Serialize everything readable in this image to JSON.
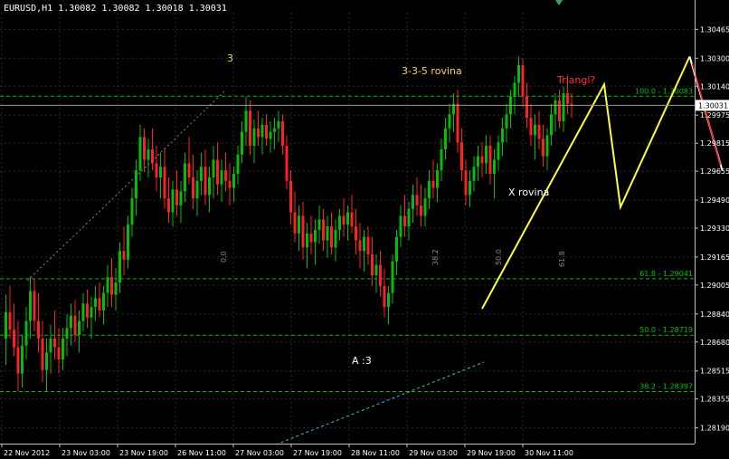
{
  "window": {
    "header_text": "EURUSD,H1  1.30082 1.30082 1.30018 1.30031"
  },
  "colors": {
    "background": "#000000",
    "grid": "#1f2f1f",
    "bull_candle": "#00c000",
    "bear_candle": "#ff2020",
    "fib_line": "#00c000",
    "pattern_yellow": "#ffff33",
    "pattern_white": "#ffffff",
    "pattern_red": "#ff2020",
    "trend_cyan": "#3fc0e0",
    "label_yellow": "#ffd24a",
    "label_red": "#ff3030",
    "axis_text": "#ffffff",
    "price_marker_bg": "#ffffff"
  },
  "chart_data": {
    "type": "candlestick",
    "symbol": "EURUSD",
    "timeframe": "H1",
    "ohlc_header": {
      "open": 1.30082,
      "high": 1.30082,
      "low": 1.30018,
      "close": 1.30031
    },
    "current_price": "1.30031",
    "y_range": [
      1.281,
      1.3056
    ],
    "y_ticks": [
      "1.30465",
      "1.30300",
      "1.30140",
      "1.29975",
      "1.29815",
      "1.29655",
      "1.29490",
      "1.29330",
      "1.29165",
      "1.29005",
      "1.28840",
      "1.28680",
      "1.28515",
      "1.28355",
      "1.28190"
    ],
    "x_ticks": [
      "22 Nov 2012",
      "23 Nov 03:00",
      "23 Nov 19:00",
      "26 Nov 11:00",
      "27 Nov 03:00",
      "27 Nov 19:00",
      "28 Nov 11:00",
      "29 Nov 03:00",
      "29 Nov 19:00",
      "30 Nov 11:00"
    ],
    "fib_levels": [
      {
        "label": "100.0 - 1.30083",
        "price": 1.30083
      },
      {
        "label": "61.8 - 1.29041",
        "price": 1.29041
      },
      {
        "label": "50.0 - 1.28719",
        "price": 1.28719
      },
      {
        "label": "38.2 - 1.28397",
        "price": 1.28397
      }
    ],
    "fib_time_labels": [
      "0.0",
      "38.2",
      "50.0",
      "61.8"
    ],
    "annotations": {
      "wave_3": "3",
      "wave_335": "3-3-5 rovina",
      "triangle": "Triangl?",
      "x_flat": "X rovina",
      "a3": "A :3"
    },
    "pattern_points": [
      {
        "bar": 117,
        "price": 1.2887
      },
      {
        "bar": 147,
        "price": 1.3015
      },
      {
        "bar": 151,
        "price": 1.2945
      },
      {
        "bar": 168,
        "price": 1.3031
      },
      {
        "bar": 176,
        "price": 1.2966
      }
    ],
    "zigzag_tail": [
      {
        "bar": 168,
        "price": 1.3031
      },
      {
        "bar": 176,
        "price": 1.2966
      }
    ],
    "candles": [
      [
        1.287,
        1.2895,
        1.2855,
        1.2885
      ],
      [
        1.2885,
        1.29,
        1.287,
        1.2875
      ],
      [
        1.2875,
        1.289,
        1.286,
        1.2865
      ],
      [
        1.2865,
        1.288,
        1.284,
        1.285
      ],
      [
        1.285,
        1.2872,
        1.2842,
        1.2866
      ],
      [
        1.2866,
        1.2888,
        1.2858,
        1.288
      ],
      [
        1.288,
        1.2905,
        1.287,
        1.2897
      ],
      [
        1.2897,
        1.2904,
        1.2874,
        1.288
      ],
      [
        1.288,
        1.2896,
        1.2862,
        1.287
      ],
      [
        1.287,
        1.288,
        1.2845,
        1.2852
      ],
      [
        1.2852,
        1.287,
        1.284,
        1.2862
      ],
      [
        1.2862,
        1.2878,
        1.285,
        1.287
      ],
      [
        1.287,
        1.2886,
        1.2858,
        1.2865
      ],
      [
        1.2865,
        1.2876,
        1.285,
        1.2858
      ],
      [
        1.2858,
        1.2876,
        1.2852,
        1.287
      ],
      [
        1.287,
        1.2884,
        1.286,
        1.2876
      ],
      [
        1.2876,
        1.289,
        1.2866,
        1.2883
      ],
      [
        1.2883,
        1.2892,
        1.2868,
        1.2872
      ],
      [
        1.2872,
        1.2886,
        1.2862,
        1.288
      ],
      [
        1.288,
        1.2896,
        1.2874,
        1.289
      ],
      [
        1.289,
        1.2898,
        1.2876,
        1.2882
      ],
      [
        1.2882,
        1.2894,
        1.287,
        1.2888
      ],
      [
        1.2888,
        1.29,
        1.288,
        1.2893
      ],
      [
        1.2893,
        1.2902,
        1.2882,
        1.2886
      ],
      [
        1.2886,
        1.29,
        1.2878,
        1.2896
      ],
      [
        1.2896,
        1.2912,
        1.2888,
        1.2905
      ],
      [
        1.2905,
        1.2916,
        1.2888,
        1.2895
      ],
      [
        1.2895,
        1.291,
        1.2886,
        1.2902
      ],
      [
        1.2902,
        1.2925,
        1.2896,
        1.292
      ],
      [
        1.292,
        1.2934,
        1.2906,
        1.2915
      ],
      [
        1.2915,
        1.294,
        1.291,
        1.2935
      ],
      [
        1.2935,
        1.2956,
        1.2928,
        1.295
      ],
      [
        1.295,
        1.2972,
        1.294,
        1.2966
      ],
      [
        1.2966,
        1.2992,
        1.296,
        1.2985
      ],
      [
        1.2985,
        1.299,
        1.2965,
        1.2972
      ],
      [
        1.2972,
        1.2984,
        1.2962,
        1.2978
      ],
      [
        1.2978,
        1.299,
        1.2966,
        1.297
      ],
      [
        1.297,
        1.298,
        1.2954,
        1.2962
      ],
      [
        1.2962,
        1.2976,
        1.295,
        1.2968
      ],
      [
        1.2968,
        1.2978,
        1.2944,
        1.295
      ],
      [
        1.295,
        1.2962,
        1.2936,
        1.2942
      ],
      [
        1.2942,
        1.296,
        1.2934,
        1.2955
      ],
      [
        1.2955,
        1.2966,
        1.294,
        1.2946
      ],
      [
        1.2946,
        1.296,
        1.2936,
        1.2954
      ],
      [
        1.2954,
        1.2976,
        1.2948,
        1.297
      ],
      [
        1.297,
        1.2985,
        1.2958,
        1.2962
      ],
      [
        1.2962,
        1.2975,
        1.2944,
        1.295
      ],
      [
        1.295,
        1.2966,
        1.294,
        1.296
      ],
      [
        1.296,
        1.2976,
        1.2952,
        1.2968
      ],
      [
        1.2968,
        1.2978,
        1.2946,
        1.2952
      ],
      [
        1.2952,
        1.2968,
        1.2942,
        1.2962
      ],
      [
        1.2962,
        1.298,
        1.295,
        1.2972
      ],
      [
        1.2972,
        1.2982,
        1.2952,
        1.2958
      ],
      [
        1.2958,
        1.2972,
        1.2948,
        1.2966
      ],
      [
        1.2966,
        1.2976,
        1.2954,
        1.296
      ],
      [
        1.296,
        1.297,
        1.2946,
        1.2956
      ],
      [
        1.2956,
        1.2968,
        1.2948,
        1.2964
      ],
      [
        1.2964,
        1.298,
        1.2958,
        1.2975
      ],
      [
        1.2975,
        1.2994,
        1.297,
        1.2988
      ],
      [
        1.2988,
        1.3008,
        1.298,
        1.3
      ],
      [
        1.3,
        1.3006,
        1.2975,
        1.298
      ],
      [
        1.298,
        1.2995,
        1.297,
        1.299
      ],
      [
        1.299,
        1.3,
        1.298,
        1.2985
      ],
      [
        1.2985,
        1.2996,
        1.2975,
        1.2992
      ],
      [
        1.2992,
        1.2998,
        1.298,
        1.2984
      ],
      [
        1.2984,
        1.2994,
        1.2976,
        1.2988
      ],
      [
        1.2988,
        1.2996,
        1.2978,
        1.299
      ],
      [
        1.299,
        1.3,
        1.2982,
        1.2994
      ],
      [
        1.2994,
        1.2998,
        1.2975,
        1.298
      ],
      [
        1.298,
        1.2986,
        1.2955,
        1.296
      ],
      [
        1.296,
        1.2966,
        1.2935,
        1.2942
      ],
      [
        1.2942,
        1.2954,
        1.2925,
        1.293
      ],
      [
        1.293,
        1.2946,
        1.292,
        1.294
      ],
      [
        1.294,
        1.2948,
        1.2915,
        1.2922
      ],
      [
        1.2922,
        1.2936,
        1.291,
        1.293
      ],
      [
        1.293,
        1.294,
        1.2918,
        1.2925
      ],
      [
        1.2925,
        1.2938,
        1.2912,
        1.2932
      ],
      [
        1.2932,
        1.2946,
        1.2924,
        1.2938
      ],
      [
        1.2938,
        1.2944,
        1.292,
        1.2926
      ],
      [
        1.2926,
        1.294,
        1.2916,
        1.2934
      ],
      [
        1.2934,
        1.2942,
        1.2918,
        1.2922
      ],
      [
        1.2922,
        1.2938,
        1.2914,
        1.2932
      ],
      [
        1.2932,
        1.2944,
        1.2926,
        1.294
      ],
      [
        1.294,
        1.295,
        1.2928,
        1.2935
      ],
      [
        1.2935,
        1.2946,
        1.2926,
        1.2942
      ],
      [
        1.2942,
        1.2952,
        1.293,
        1.2934
      ],
      [
        1.2934,
        1.2944,
        1.2918,
        1.2926
      ],
      [
        1.2926,
        1.2936,
        1.291,
        1.292
      ],
      [
        1.292,
        1.2932,
        1.2908,
        1.2928
      ],
      [
        1.2928,
        1.2934,
        1.2912,
        1.2918
      ],
      [
        1.2918,
        1.2928,
        1.29,
        1.2906
      ],
      [
        1.2906,
        1.2918,
        1.2896,
        1.2912
      ],
      [
        1.2912,
        1.292,
        1.2894,
        1.29
      ],
      [
        1.29,
        1.291,
        1.2882,
        1.2888
      ],
      [
        1.2888,
        1.29,
        1.2878,
        1.2896
      ],
      [
        1.2896,
        1.2918,
        1.289,
        1.2914
      ],
      [
        1.2914,
        1.2932,
        1.2906,
        1.2928
      ],
      [
        1.2928,
        1.2946,
        1.2922,
        1.294
      ],
      [
        1.294,
        1.2952,
        1.2928,
        1.2934
      ],
      [
        1.2934,
        1.2948,
        1.2926,
        1.2944
      ],
      [
        1.2944,
        1.2958,
        1.2936,
        1.2952
      ],
      [
        1.2952,
        1.2962,
        1.294,
        1.2946
      ],
      [
        1.2946,
        1.2958,
        1.2934,
        1.294
      ],
      [
        1.294,
        1.2956,
        1.2934,
        1.295
      ],
      [
        1.295,
        1.2966,
        1.2944,
        1.296
      ],
      [
        1.296,
        1.2972,
        1.295,
        1.2956
      ],
      [
        1.2956,
        1.297,
        1.2948,
        1.2966
      ],
      [
        1.2966,
        1.2984,
        1.296,
        1.2978
      ],
      [
        1.2978,
        1.2996,
        1.2972,
        1.299
      ],
      [
        1.299,
        1.3004,
        1.2982,
        1.2998
      ],
      [
        1.2998,
        1.301,
        1.2988,
        1.3004
      ],
      [
        1.3004,
        1.3012,
        1.2976,
        1.2982
      ],
      [
        1.2982,
        1.299,
        1.296,
        1.2966
      ],
      [
        1.2966,
        1.2972,
        1.2946,
        1.2952
      ],
      [
        1.2952,
        1.2966,
        1.2945,
        1.296
      ],
      [
        1.296,
        1.2974,
        1.2954,
        1.2968
      ],
      [
        1.2968,
        1.298,
        1.296,
        1.2974
      ],
      [
        1.2974,
        1.2982,
        1.2962,
        1.297
      ],
      [
        1.297,
        1.2986,
        1.2964,
        1.298
      ],
      [
        1.298,
        1.2986,
        1.2958,
        1.2964
      ],
      [
        1.2964,
        1.2978,
        1.295,
        1.2972
      ],
      [
        1.2972,
        1.2986,
        1.2966,
        1.2982
      ],
      [
        1.2982,
        1.2996,
        1.2974,
        1.299
      ],
      [
        1.299,
        1.3004,
        1.2982,
        1.2998
      ],
      [
        1.2998,
        1.3012,
        1.299,
        1.3008
      ],
      [
        1.3008,
        1.302,
        1.2998,
        1.3016
      ],
      [
        1.3016,
        1.3031,
        1.3008,
        1.3026
      ],
      [
        1.3026,
        1.303,
        1.3002,
        1.3008
      ],
      [
        1.3008,
        1.3016,
        1.299,
        1.2996
      ],
      [
        1.2996,
        1.3004,
        1.298,
        1.2986
      ],
      [
        1.2986,
        1.2998,
        1.2972,
        1.2992
      ],
      [
        1.2992,
        1.3,
        1.2978,
        1.2984
      ],
      [
        1.2984,
        1.2992,
        1.2968,
        1.2974
      ],
      [
        1.2974,
        1.299,
        1.2966,
        1.2986
      ],
      [
        1.2986,
        1.3004,
        1.298,
        1.2998
      ],
      [
        1.2998,
        1.301,
        1.2988,
        1.3006
      ],
      [
        1.3006,
        1.3012,
        1.299,
        1.2994
      ],
      [
        1.2994,
        1.3014,
        1.2988,
        1.301
      ],
      [
        1.301,
        1.302,
        1.2998,
        1.3004
      ],
      [
        1.3004,
        1.301,
        1.2996,
        1.3003
      ]
    ],
    "title": "",
    "xlabel": "",
    "ylabel": "",
    "grid": true,
    "legend": "none"
  }
}
